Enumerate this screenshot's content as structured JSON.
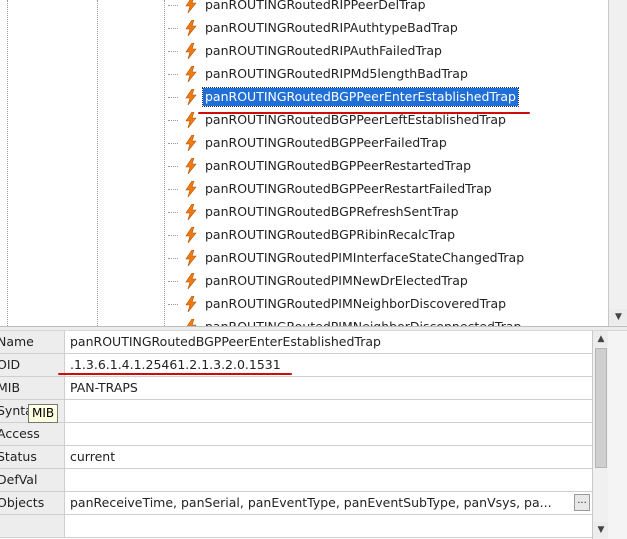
{
  "tree": {
    "items": [
      {
        "label": "panROUTINGRoutedRIPPeerDelTrap",
        "selected": false
      },
      {
        "label": "panROUTINGRoutedRIPAuthtypeBadTrap",
        "selected": false
      },
      {
        "label": "panROUTINGRoutedRIPAuthFailedTrap",
        "selected": false
      },
      {
        "label": "panROUTINGRoutedRIPMd5lengthBadTrap",
        "selected": false
      },
      {
        "label": "panROUTINGRoutedBGPPeerEnterEstablishedTrap",
        "selected": true
      },
      {
        "label": "panROUTINGRoutedBGPPeerLeftEstablishedTrap",
        "selected": false
      },
      {
        "label": "panROUTINGRoutedBGPPeerFailedTrap",
        "selected": false
      },
      {
        "label": "panROUTINGRoutedBGPPeerRestartedTrap",
        "selected": false
      },
      {
        "label": "panROUTINGRoutedBGPPeerRestartFailedTrap",
        "selected": false
      },
      {
        "label": "panROUTINGRoutedBGPRefreshSentTrap",
        "selected": false
      },
      {
        "label": "panROUTINGRoutedBGPRibinRecalcTrap",
        "selected": false
      },
      {
        "label": "panROUTINGRoutedPIMInterfaceStateChangedTrap",
        "selected": false
      },
      {
        "label": "panROUTINGRoutedPIMNewDrElectedTrap",
        "selected": false
      },
      {
        "label": "panROUTINGRoutedPIMNeighborDiscoveredTrap",
        "selected": false
      },
      {
        "label": "panROUTINGRoutedPIMNeighborDisconnectedTrap",
        "selected": false
      }
    ],
    "icon": "trap-lightning-icon"
  },
  "properties": {
    "rows": [
      {
        "key": "Name",
        "value": "panROUTINGRoutedBGPPeerEnterEstablishedTrap"
      },
      {
        "key": "OID",
        "value": ".1.3.6.1.4.1.25461.2.1.3.2.0.1531"
      },
      {
        "key": "MIB",
        "value": "PAN-TRAPS"
      },
      {
        "key": "Syntax",
        "value": ""
      },
      {
        "key": "Access",
        "value": ""
      },
      {
        "key": "Status",
        "value": "current"
      },
      {
        "key": "DefVal",
        "value": ""
      },
      {
        "key": "Objects",
        "value": "panReceiveTime, panSerial, panEventType, panEventSubType, panVsys, pa..."
      },
      {
        "key": "",
        "value": ""
      }
    ],
    "objects_more_label": "...",
    "tooltip": "MIB"
  },
  "scrollbars": {
    "up_arrow": "▲",
    "down_arrow": "▼"
  },
  "colors": {
    "selection": "#1f6fd6",
    "annotation": "#d10a0a",
    "icon": "#f07b12"
  }
}
